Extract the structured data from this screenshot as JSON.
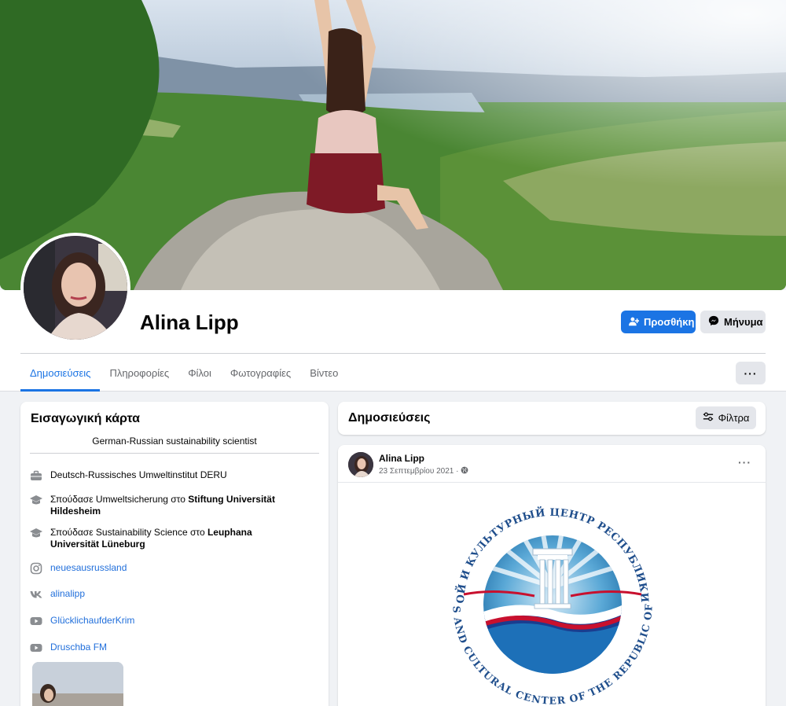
{
  "profile": {
    "name": "Alina Lipp",
    "add_label": "Προσθήκη",
    "message_label": "Μήνυμα"
  },
  "tabs": [
    {
      "label": "Δημοσιεύσεις",
      "active": true
    },
    {
      "label": "Πληροφορίες",
      "active": false
    },
    {
      "label": "Φίλοι",
      "active": false
    },
    {
      "label": "Φωτογραφίες",
      "active": false
    },
    {
      "label": "Βίντεο",
      "active": false
    }
  ],
  "more_label": "···",
  "intro": {
    "title": "Εισαγωγική κάρτα",
    "bio": "German-Russian sustainability scientist",
    "work": "Deutsch-Russisches Umweltinstitut DERU",
    "edu1_prefix": "Σπούδασε Umweltsicherung στο",
    "edu1_school": "Stiftung Universität Hildesheim",
    "edu2_prefix": "Σπούδασε Sustainability Science στο",
    "edu2_school": "Leuphana Universität Lüneburg",
    "links": [
      {
        "icon": "instagram-icon",
        "label": "neuesausrussland"
      },
      {
        "icon": "vk-icon",
        "label": "alinalipp"
      },
      {
        "icon": "youtube-icon",
        "label": "GlücklichaufderKrim"
      },
      {
        "icon": "youtube-icon",
        "label": "Druschba FM"
      }
    ]
  },
  "posts_header": {
    "title": "Δημοσιεύσεις",
    "filter_label": "Φίλτρα"
  },
  "post": {
    "author": "Alina Lipp",
    "date": "23 Σεπτεμβρίου 2021 ·",
    "more_label": "···",
    "logo_text_top": "ДЕЛОВОЙ И КУЛЬТУРНЫЙ ЦЕНТР РЕСПУБЛИКИ КРЫМ",
    "logo_text_bottom": "BUSINESS AND CULTURAL CENTER OF THE REPUBLIC OF CRIMEA"
  },
  "colors": {
    "accent": "#1b74e4",
    "link": "#216fdb",
    "background": "#f0f2f5"
  }
}
